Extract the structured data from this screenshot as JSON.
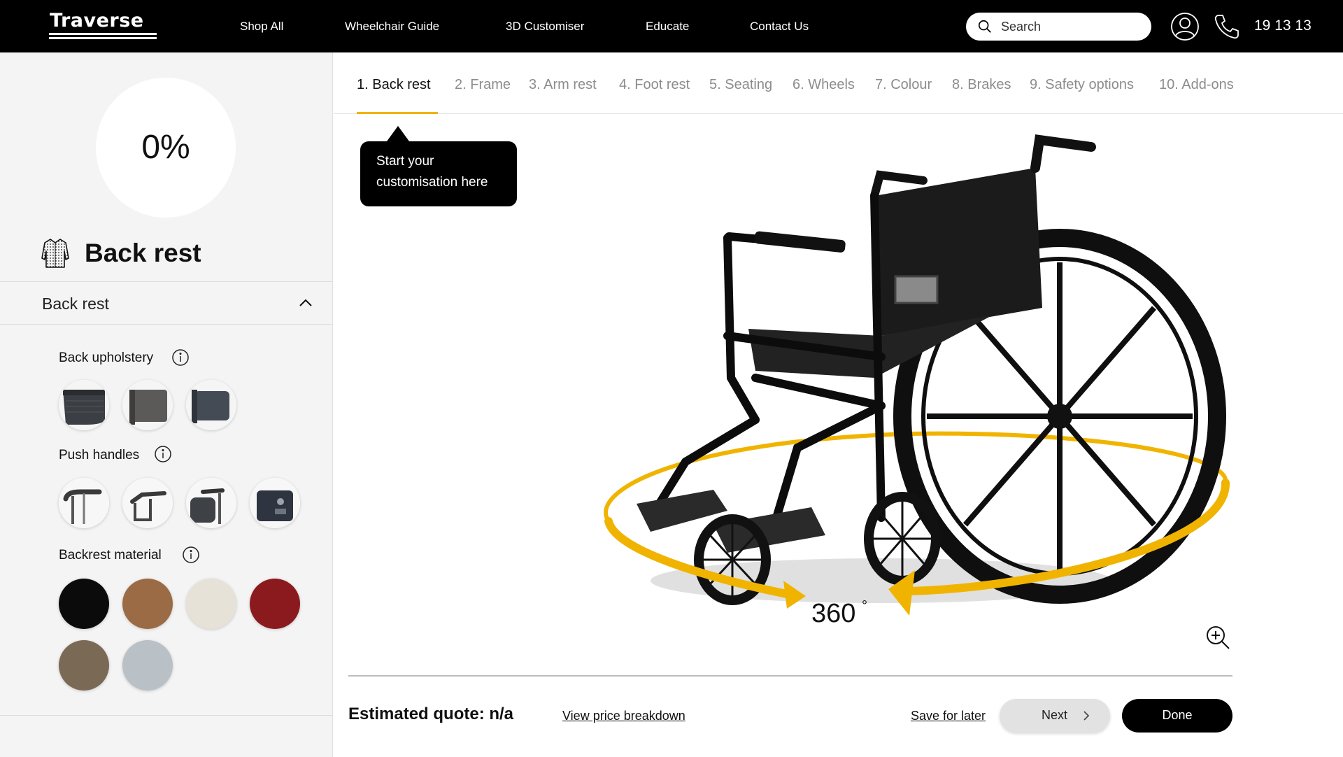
{
  "header": {
    "logo": "Traverse",
    "nav": [
      "Shop All",
      "Wheelchair Guide",
      "3D Customiser",
      "Educate",
      "Contact Us"
    ],
    "search_placeholder": "Search",
    "phone": "19 13 13"
  },
  "sidebar": {
    "progress": "0%",
    "progress_value": 0,
    "section_title": "Back rest",
    "accordion_label": "Back rest",
    "options": [
      {
        "label": "Back upholstery",
        "swatch_count": 3
      },
      {
        "label": "Push handles",
        "swatch_count": 4
      },
      {
        "label": "Backrest material",
        "swatch_count": 6
      }
    ],
    "material_colors": [
      "#0b0b0b",
      "#9a6b45",
      "#e7e2d8",
      "#8b1a1f",
      "#7a6a55",
      "#b9c0c6"
    ]
  },
  "tabs": [
    "1.  Back rest",
    "2. Frame",
    "3. Arm rest",
    "4. Foot rest",
    "5. Seating",
    "6. Wheels",
    "7. Colour",
    "8. Brakes",
    "9. Safety options",
    "10. Add-ons"
  ],
  "active_tab": 0,
  "tooltip": {
    "line1": "Start your",
    "line2": "customisation here"
  },
  "viewer": {
    "rotate_label": "360",
    "degree_symbol": "°",
    "accent_color": "#f0b400"
  },
  "footer": {
    "quote": "Estimated quote: n/a",
    "price_breakdown": "View price breakdown",
    "save_later": "Save for later",
    "next": "Next",
    "done": "Done"
  }
}
